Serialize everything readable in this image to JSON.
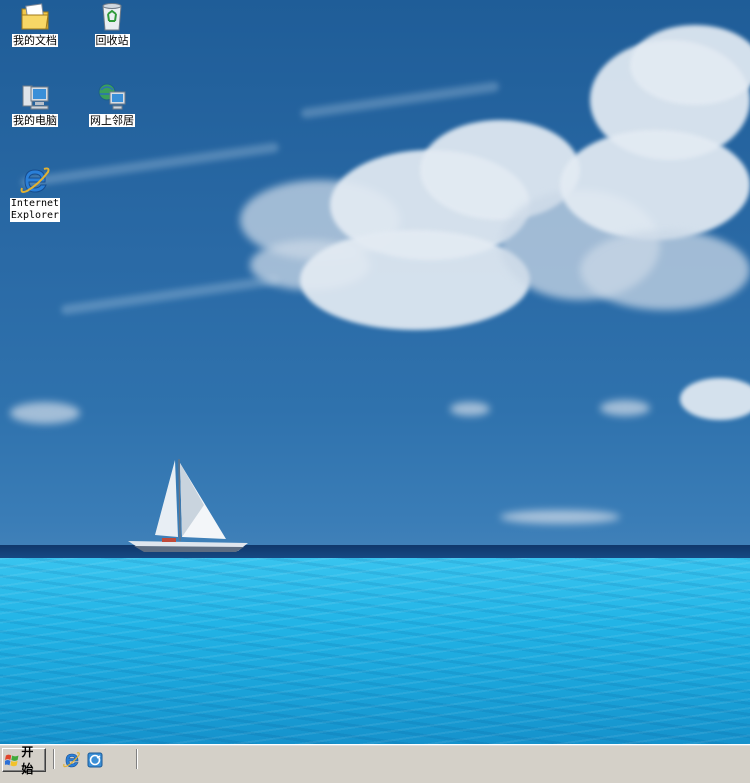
{
  "desktop": {
    "icons": [
      {
        "label": "我的文档",
        "icon": "my-documents-icon"
      },
      {
        "label": "回收站",
        "icon": "recycle-bin-icon"
      },
      {
        "label": "我的电脑",
        "icon": "my-computer-icon"
      },
      {
        "label": "网上邻居",
        "icon": "network-places-icon"
      },
      {
        "label": "Internet\nExplorer",
        "icon": "internet-explorer-icon"
      }
    ]
  },
  "taskbar": {
    "start_label": "开始",
    "quick_launch": [
      {
        "icon": "internet-explorer-icon"
      },
      {
        "icon": "outlook-express-icon"
      }
    ]
  },
  "colors": {
    "taskbar": "#d4d0c8",
    "sky": "#2a6aa6",
    "sea": "#22b4e6"
  }
}
